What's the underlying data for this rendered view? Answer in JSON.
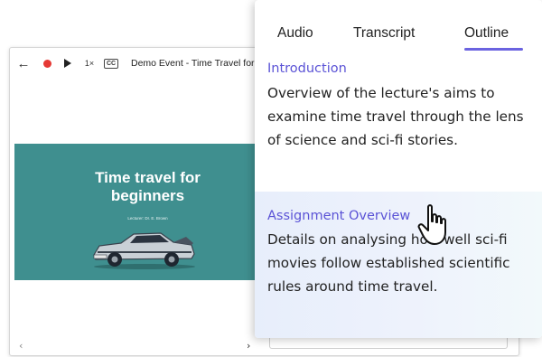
{
  "player": {
    "back_icon": "←",
    "speed": "1×",
    "cc": "CC",
    "event_title": "Demo Event - Time Travel for Be",
    "slide": {
      "title_line1": "Time travel for",
      "title_line2": "beginners",
      "lecturer": "Lecturer: Dr. E. Brown"
    },
    "nav_prev": "‹",
    "nav_next": "›"
  },
  "panel": {
    "tabs": [
      {
        "label": "Audio"
      },
      {
        "label": "Transcript"
      },
      {
        "label": "Outline",
        "active": true
      }
    ],
    "sections": [
      {
        "heading": "Introduction",
        "body": "Overview of the lecture's aims to examine time travel through the lens of science and sci-fi stories."
      },
      {
        "heading": "Assignment Overview",
        "body": "Details on analysing how well sci-fi movies follow established scientific rules around time travel."
      }
    ]
  },
  "colors": {
    "accent": "#6b63e0",
    "heading": "#5b53d6",
    "slide_bg": "#3f8f8f",
    "record": "#e53935",
    "highlight_row": "#e9effb"
  }
}
